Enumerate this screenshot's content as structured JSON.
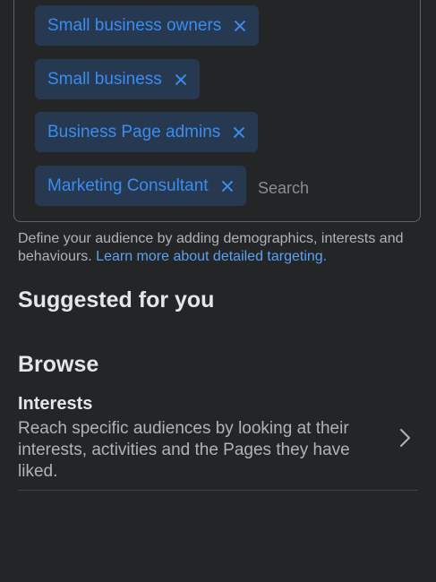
{
  "targeting": {
    "chips": [
      {
        "label": "Small business owners"
      },
      {
        "label": "Small business"
      },
      {
        "label": "Business Page admins"
      },
      {
        "label": "Marketing Consultant"
      }
    ],
    "search_placeholder": "Search"
  },
  "help": {
    "text": "Define your audience by adding demographics, interests and behaviours. ",
    "link": "Learn more about detailed targeting."
  },
  "suggested": {
    "title": "Suggested for you"
  },
  "browse": {
    "title": "Browse",
    "items": [
      {
        "title": "Interests",
        "description": "Reach specific audiences by looking at their interests, activities and the Pages they have liked.",
        "icon": "chevron-right-icon"
      }
    ]
  },
  "colors": {
    "background": "#242526",
    "chip_bg": "#263951",
    "accent": "#3a8df0",
    "link": "#5aa2f5"
  }
}
